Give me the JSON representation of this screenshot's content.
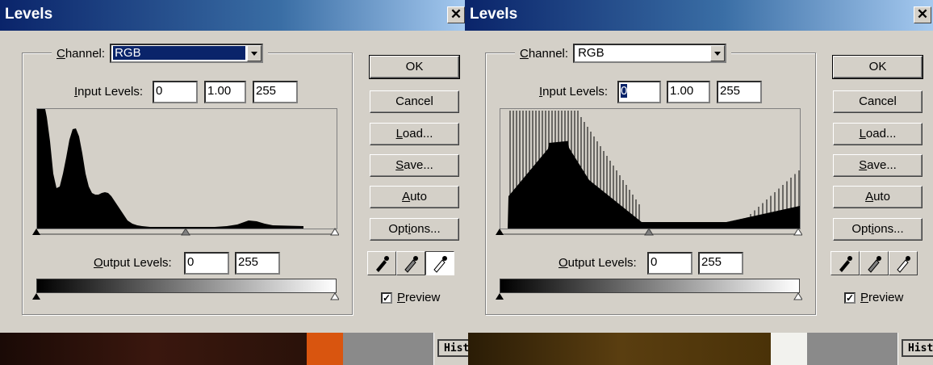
{
  "left_dialog": {
    "title": "Levels",
    "close": "✕",
    "channel_label": "Channel:",
    "channel_value": "RGB",
    "input_levels_label": "Input Levels:",
    "input_black": "0",
    "input_gamma": "1.00",
    "input_white": "255",
    "output_levels_label": "Output Levels:",
    "output_black": "0",
    "output_white": "255",
    "buttons": {
      "ok": "OK",
      "cancel": "Cancel",
      "load": "Load...",
      "save": "Save...",
      "auto": "Auto",
      "options": "Options..."
    },
    "preview_label": "Preview",
    "preview_checked": true
  },
  "right_dialog": {
    "title": "Levels",
    "close": "✕",
    "channel_label": "Channel:",
    "channel_value": "RGB",
    "input_levels_label": "Input Levels:",
    "input_black": "0",
    "input_gamma": "1.00",
    "input_white": "255",
    "output_levels_label": "Output Levels:",
    "output_black": "0",
    "output_white": "255",
    "buttons": {
      "ok": "OK",
      "cancel": "Cancel",
      "load": "Load...",
      "save": "Save...",
      "auto": "Auto",
      "options": "Options..."
    },
    "preview_label": "Preview",
    "preview_checked": true
  },
  "background": {
    "left_hist_tab": "Hist",
    "right_hist_tab": "Hist"
  },
  "colors": {
    "title_gradient_start": "#0a246a",
    "dialog_bg": "#d4d0c8",
    "selection": "#0a246a"
  }
}
